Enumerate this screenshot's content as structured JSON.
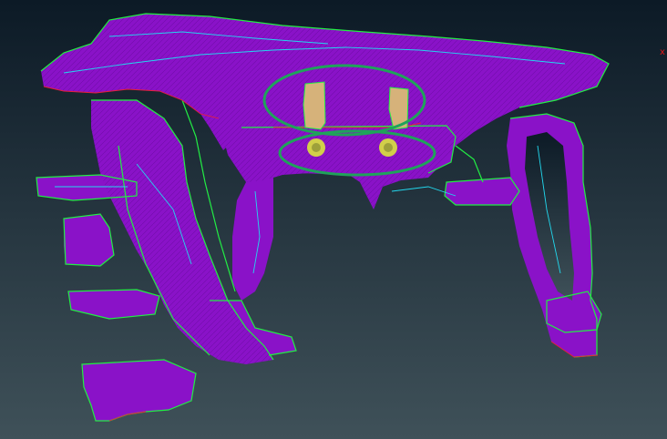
{
  "viewport": {
    "background_top": "#0c1a26",
    "background_bottom": "#3f5159"
  },
  "model": {
    "fill_color": "#8a12c8",
    "fill_dark": "#6a0aa0",
    "mesh_edge_green": "#22ee44",
    "mesh_edge_cyan": "#22d8ee",
    "mesh_edge_red": "#e8203a",
    "part_yellow": "#d2cf4a",
    "part_tan": "#d6b27a"
  },
  "highlights": {
    "color": "#1fa35a",
    "count": 2
  },
  "axis_indicator": {
    "label": "x",
    "color": "#e01818"
  }
}
